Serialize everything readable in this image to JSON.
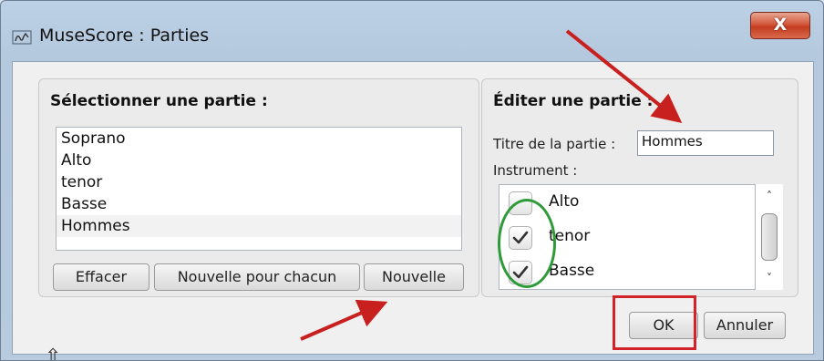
{
  "window": {
    "title": "MuseScore : Parties",
    "close_label": "X"
  },
  "select_panel": {
    "heading": "Sélectionner une partie :",
    "parts": [
      "Soprano",
      "Alto",
      "tenor",
      "Basse",
      "Hommes"
    ],
    "selected_part": "Hommes",
    "buttons": {
      "clear": "Effacer",
      "new_each": "Nouvelle pour chacun",
      "new": "Nouvelle"
    }
  },
  "edit_panel": {
    "heading": "Éditer une partie :",
    "title_label": "Titre de la partie :",
    "title_value": "Hommes",
    "instrument_label": "Instrument :",
    "instruments": [
      {
        "name": "Alto",
        "checked": false
      },
      {
        "name": "tenor",
        "checked": true
      },
      {
        "name": "Basse",
        "checked": true
      }
    ]
  },
  "dialog_buttons": {
    "ok": "OK",
    "cancel": "Annuler"
  },
  "annotations": {
    "arrow_color": "#c8201f",
    "box_color": "#d3232a",
    "circle_color": "#2e9a38"
  },
  "icons": {
    "app": "musescore-app-icon",
    "close": "close-icon",
    "scroll_up": "chevron-up-icon",
    "scroll_down": "chevron-down-icon",
    "checkmark": "checkmark-icon",
    "cursor": "arrow-cursor-icon"
  }
}
